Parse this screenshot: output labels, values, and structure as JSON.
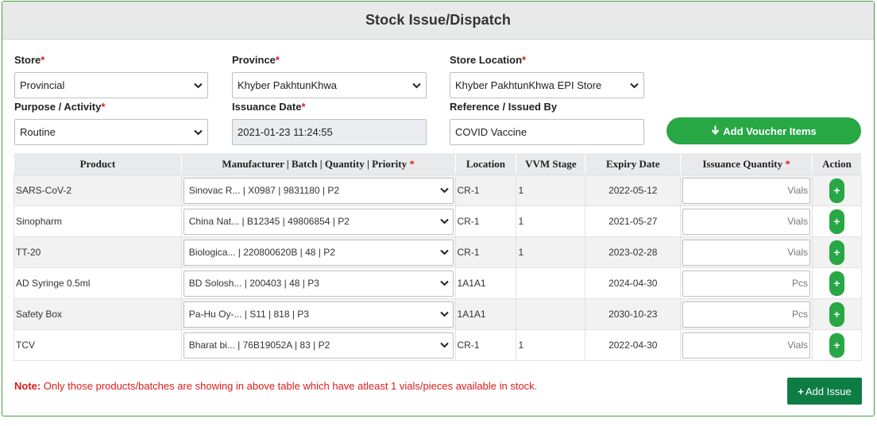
{
  "header": {
    "title": "Stock Issue/Dispatch"
  },
  "form": {
    "store": {
      "label": "Store",
      "value": "Provincial"
    },
    "province": {
      "label": "Province",
      "value": "Khyber PakhtunKhwa"
    },
    "store_location": {
      "label": "Store Location",
      "value": "Khyber PakhtunKhwa EPI Store"
    },
    "purpose": {
      "label": "Purpose / Activity",
      "value": "Routine"
    },
    "issuance_date": {
      "label": "Issuance Date",
      "value": "2021-01-23 11:24:55"
    },
    "reference": {
      "label": "Reference / Issued By",
      "value": "COVID Vaccine"
    },
    "required_mark": "*"
  },
  "buttons": {
    "add_voucher": "Add Voucher Items",
    "add_issue": "Add Issue",
    "plus": "+"
  },
  "table": {
    "headers": {
      "product": "Product",
      "batch": "Manufacturer | Batch | Quantity | Priority",
      "location": "Location",
      "vvm": "VVM Stage",
      "expiry": "Expiry Date",
      "qty": "Issuance Quantity",
      "action": "Action"
    },
    "rows": [
      {
        "product": "SARS-CoV-2",
        "batch": "Sinovac R... | X0987 | 9831180 | P2",
        "location": "CR-1",
        "vvm": "1",
        "expiry": "2022-05-12",
        "unit": "Vials"
      },
      {
        "product": "Sinopharm",
        "batch": "China Nat... | B12345 | 49806854 | P2",
        "location": "CR-1",
        "vvm": "1",
        "expiry": "2021-05-27",
        "unit": "Vials"
      },
      {
        "product": "TT-20",
        "batch": "Biologica... | 220800620B | 48 | P2",
        "location": "CR-1",
        "vvm": "1",
        "expiry": "2023-02-28",
        "unit": "Vials"
      },
      {
        "product": "AD Syringe 0.5ml",
        "batch": "BD Solosh... | 200403 | 48 | P3",
        "location": "1A1A1",
        "vvm": "",
        "expiry": "2024-04-30",
        "unit": "Pcs"
      },
      {
        "product": "Safety Box",
        "batch": "Pa-Hu Oy-... | S11 | 818 | P3",
        "location": "1A1A1",
        "vvm": "",
        "expiry": "2030-10-23",
        "unit": "Pcs"
      },
      {
        "product": "TCV",
        "batch": "Bharat bi... | 76B19052A | 83 | P2",
        "location": "CR-1",
        "vvm": "1",
        "expiry": "2022-04-30",
        "unit": "Vials"
      }
    ]
  },
  "note": {
    "prefix": "Note:",
    "text": " Only those products/batches are showing in above table which have atleast 1 vials/pieces available in stock."
  },
  "colors": {
    "primary_green": "#28a745",
    "dark_green": "#0d7d43",
    "required_red": "#e01b1b"
  }
}
